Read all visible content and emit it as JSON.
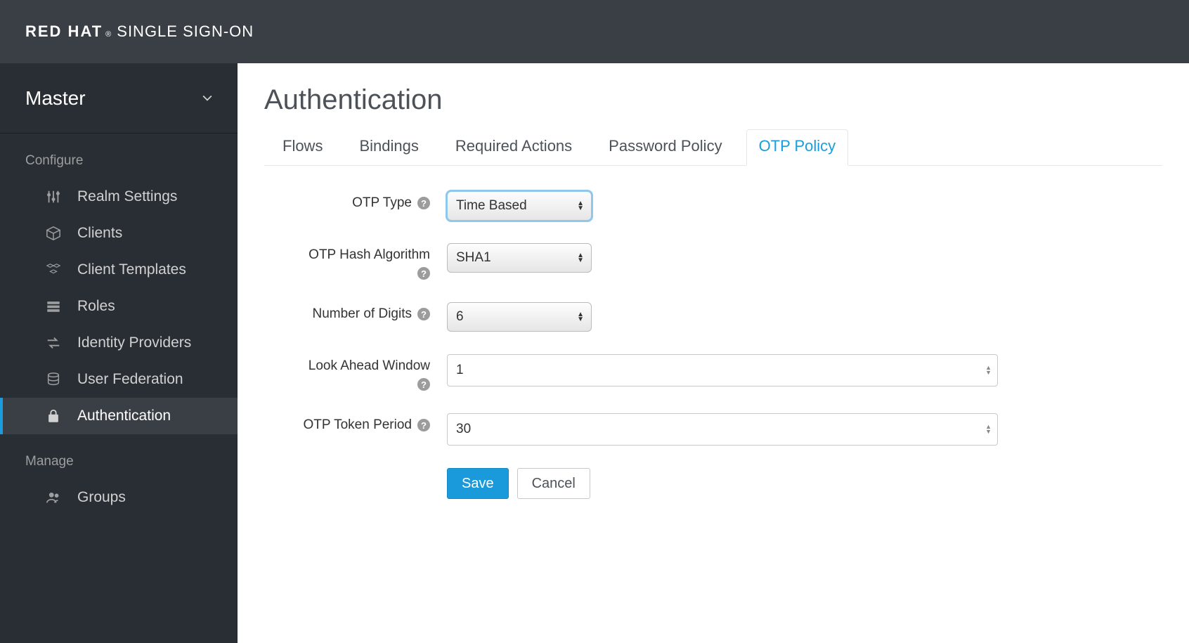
{
  "brand": {
    "strong": "RED HAT",
    "light": "SINGLE SIGN-ON"
  },
  "sidebar": {
    "realm": "Master",
    "sections": {
      "configure": "Configure",
      "manage": "Manage"
    },
    "items": {
      "realm_settings": "Realm Settings",
      "clients": "Clients",
      "client_templates": "Client Templates",
      "roles": "Roles",
      "identity_providers": "Identity Providers",
      "user_federation": "User Federation",
      "authentication": "Authentication",
      "groups": "Groups"
    }
  },
  "page": {
    "title": "Authentication"
  },
  "tabs": {
    "flows": "Flows",
    "bindings": "Bindings",
    "required_actions": "Required Actions",
    "password_policy": "Password Policy",
    "otp_policy": "OTP Policy"
  },
  "form": {
    "otp_type": {
      "label": "OTP Type",
      "value": "Time Based"
    },
    "hash_algo": {
      "label": "OTP Hash Algorithm",
      "value": "SHA1"
    },
    "digits": {
      "label": "Number of Digits",
      "value": "6"
    },
    "look_ahead": {
      "label": "Look Ahead Window",
      "value": "1"
    },
    "token_period": {
      "label": "OTP Token Period",
      "value": "30"
    },
    "save": "Save",
    "cancel": "Cancel"
  }
}
